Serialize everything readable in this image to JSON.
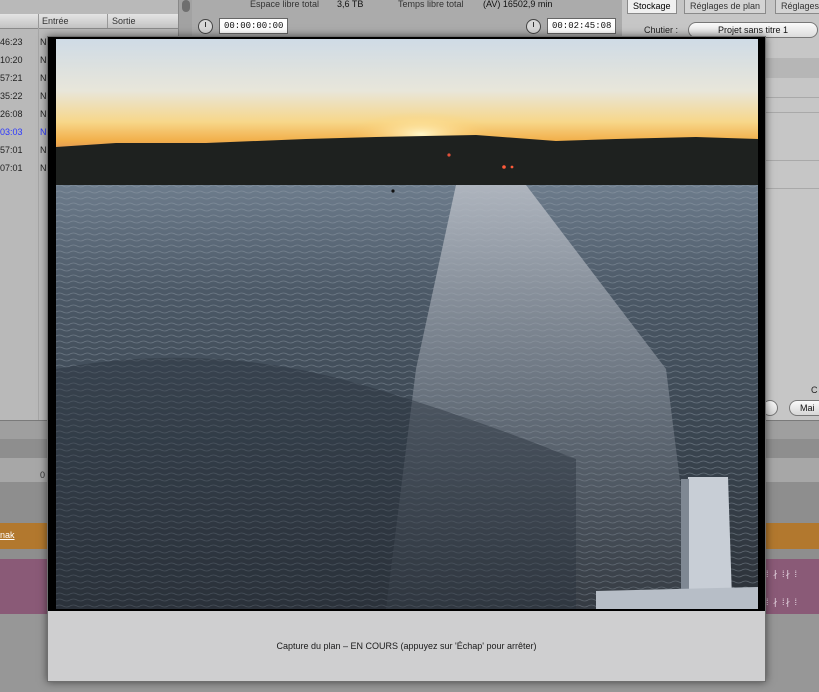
{
  "browser": {
    "col_in": "Entrée",
    "col_out": "Sortie",
    "rows": [
      {
        "tc": "46:23",
        "n": "N",
        "selected": false
      },
      {
        "tc": "10:20",
        "n": "N",
        "selected": false
      },
      {
        "tc": "57:21",
        "n": "N",
        "selected": false
      },
      {
        "tc": "35:22",
        "n": "N",
        "selected": false
      },
      {
        "tc": "26:08",
        "n": "N",
        "selected": false
      },
      {
        "tc": "03:03",
        "n": "N",
        "selected": true
      },
      {
        "tc": "57:01",
        "n": "N",
        "selected": false
      },
      {
        "tc": "07:01",
        "n": "N",
        "selected": false
      }
    ]
  },
  "status": {
    "space_label": "Espace libre total",
    "space_value": "3,6 TB",
    "time_label": "Temps libre total",
    "time_value": "(AV) 16502,9 min",
    "tc_in": "00:00:00:00",
    "tc_duration": "00:02:45:08"
  },
  "tabs": [
    {
      "label": "Stockage",
      "active": true
    },
    {
      "label": "Réglages de plan",
      "active": false
    },
    {
      "label": "Réglages",
      "active": false
    }
  ],
  "chutier": {
    "label": "Chutier :",
    "value": "Projet sans titre 1"
  },
  "right_panel": {
    "button_b": "Mai",
    "caption": "C"
  },
  "timeline": {
    "ruler_tick": "0",
    "track_label": "nak",
    "wave_marks": "⁞ ∤ ⁞∤ ⁞"
  },
  "capture": {
    "status_text": "Capture du plan – EN COURS (appuyez sur 'Échap' pour arrêter)"
  },
  "colors": {
    "sky_top": "#d9e3ec",
    "sunset": "#f6c04e",
    "hills": "#1f2220",
    "water": "#3f4d58",
    "track_orange": "#b2782e",
    "track_mauve": "#8a5a77",
    "selection_text": "#2a36ff"
  }
}
